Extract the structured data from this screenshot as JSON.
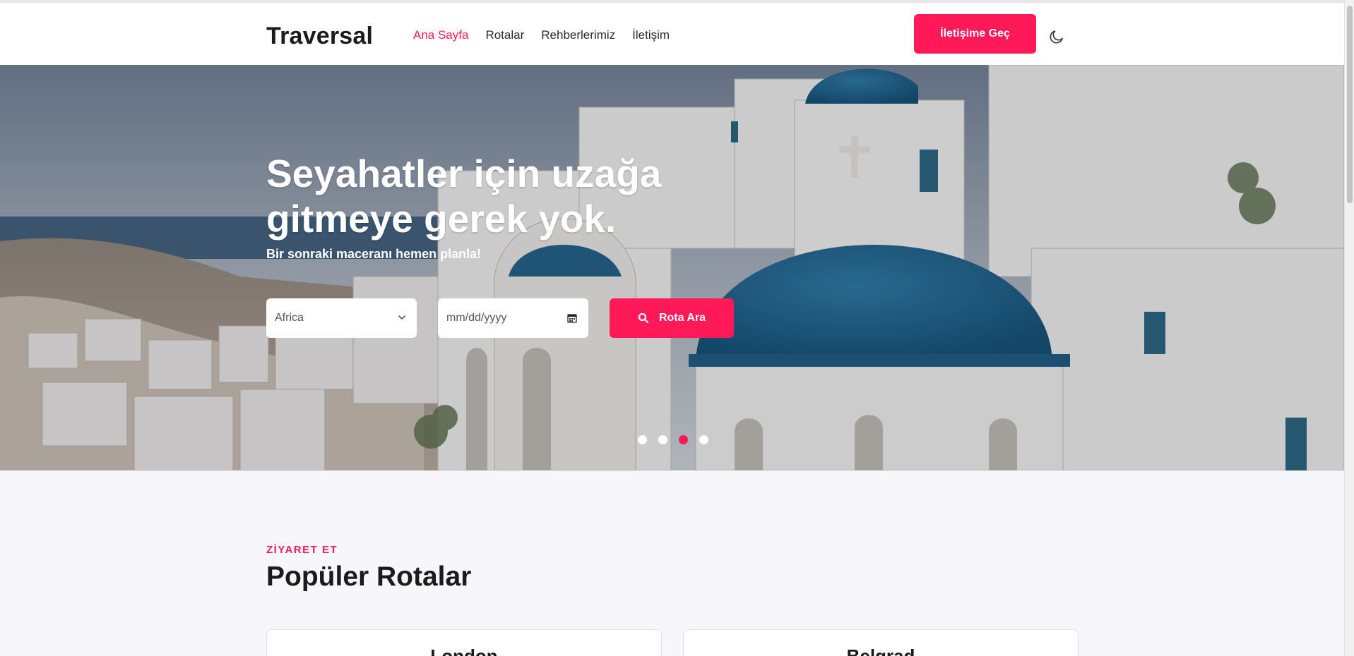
{
  "header": {
    "logo": "Traversal",
    "nav": [
      "Ana Sayfa",
      "Rotalar",
      "Rehberlerimiz",
      "İletişim"
    ],
    "active_nav": "Ana Sayfa",
    "cta_label": "İletişime Geç",
    "theme_toggle_icon": "moon-icon"
  },
  "hero": {
    "title": "Seyahatler için uzağa gitmeye gerek yok.",
    "subtitle": "Bir sonraki maceranı hemen planla!",
    "destination_select": {
      "value": "Africa"
    },
    "date_input": {
      "placeholder": "mm/dd/yyyy"
    },
    "search_button_label": "Rota Ara",
    "slider": {
      "total": 4,
      "active_index": 3
    }
  },
  "section": {
    "eyebrow": "ZİYARET ET",
    "title": "Popüler Rotalar"
  },
  "routes": [
    {
      "city": "London"
    },
    {
      "city": "Belgrad"
    }
  ],
  "colors": {
    "accent": "#ff1a57",
    "text_dark": "#1b1b1b",
    "section_bg": "#f7f7fb"
  }
}
